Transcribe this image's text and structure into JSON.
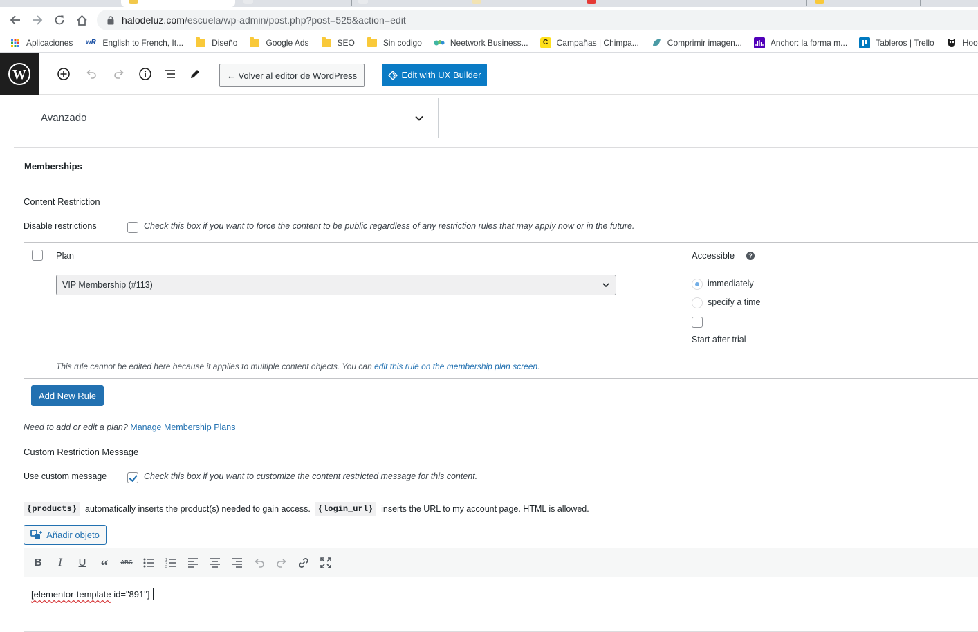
{
  "browser": {
    "url_host": "halodeluz.com",
    "url_path": "/escuela/wp-admin/post.php?post=525&action=edit"
  },
  "bookmarks": [
    {
      "label": "Aplicaciones",
      "icon": "apps-grid-icon"
    },
    {
      "label": "English to French, It...",
      "icon": "wordreference-icon"
    },
    {
      "label": "Diseño",
      "icon": "folder-icon"
    },
    {
      "label": "Google Ads",
      "icon": "folder-icon"
    },
    {
      "label": "SEO",
      "icon": "folder-icon"
    },
    {
      "label": "Sin codigo",
      "icon": "folder-icon"
    },
    {
      "label": "Neetwork Business...",
      "icon": "neetwork-icon"
    },
    {
      "label": "Campañas | Chimpa...",
      "icon": "mailchimp-icon"
    },
    {
      "label": "Comprimir imagen...",
      "icon": "leaf-icon"
    },
    {
      "label": "Anchor: la forma m...",
      "icon": "anchor-icon"
    },
    {
      "label": "Tableros | Trello",
      "icon": "trello-icon"
    },
    {
      "label": "Hootsuite",
      "icon": "owl-icon"
    }
  ],
  "header": {
    "back_label": "← Volver al editor de WordPress",
    "ux_label": "Edit with UX Builder"
  },
  "avanzado": {
    "label": "Avanzado"
  },
  "memberships": {
    "title": "Memberships",
    "content_restriction": "Content Restriction",
    "disable_label": "Disable restrictions",
    "disable_desc": "Check this box if you want to force the content to be public regardless of any restriction rules that may apply now or in the future.",
    "table": {
      "col_plan": "Plan",
      "col_accessible": "Accessible",
      "plan_value": "VIP Membership (#113)",
      "opt_immediately": "immediately",
      "opt_specify": "specify a time",
      "start_after_trial": "Start after trial",
      "note_prefix": "This rule cannot be edited here because it applies to multiple content objects. You can ",
      "note_link": "edit this rule on the membership plan screen",
      "note_suffix": ".",
      "add_rule": "Add New Rule"
    },
    "plans_prefix": "Need to add or edit a plan?",
    "plans_link": "Manage Membership Plans",
    "custom_title": "Custom Restriction Message",
    "custom_label": "Use custom message",
    "custom_desc": "Check this box if you want to customize the content restricted message for this content.",
    "tag_products": "{products}",
    "tag_products_desc": "automatically inserts the product(s) needed to gain access.",
    "tag_login": "{login_url}",
    "tag_login_desc": "inserts the URL to my account page. HTML is allowed.",
    "media_btn": "Añadir objeto",
    "editor_word1": "[elementor-template",
    "editor_rest": " id=\"891\"]"
  }
}
